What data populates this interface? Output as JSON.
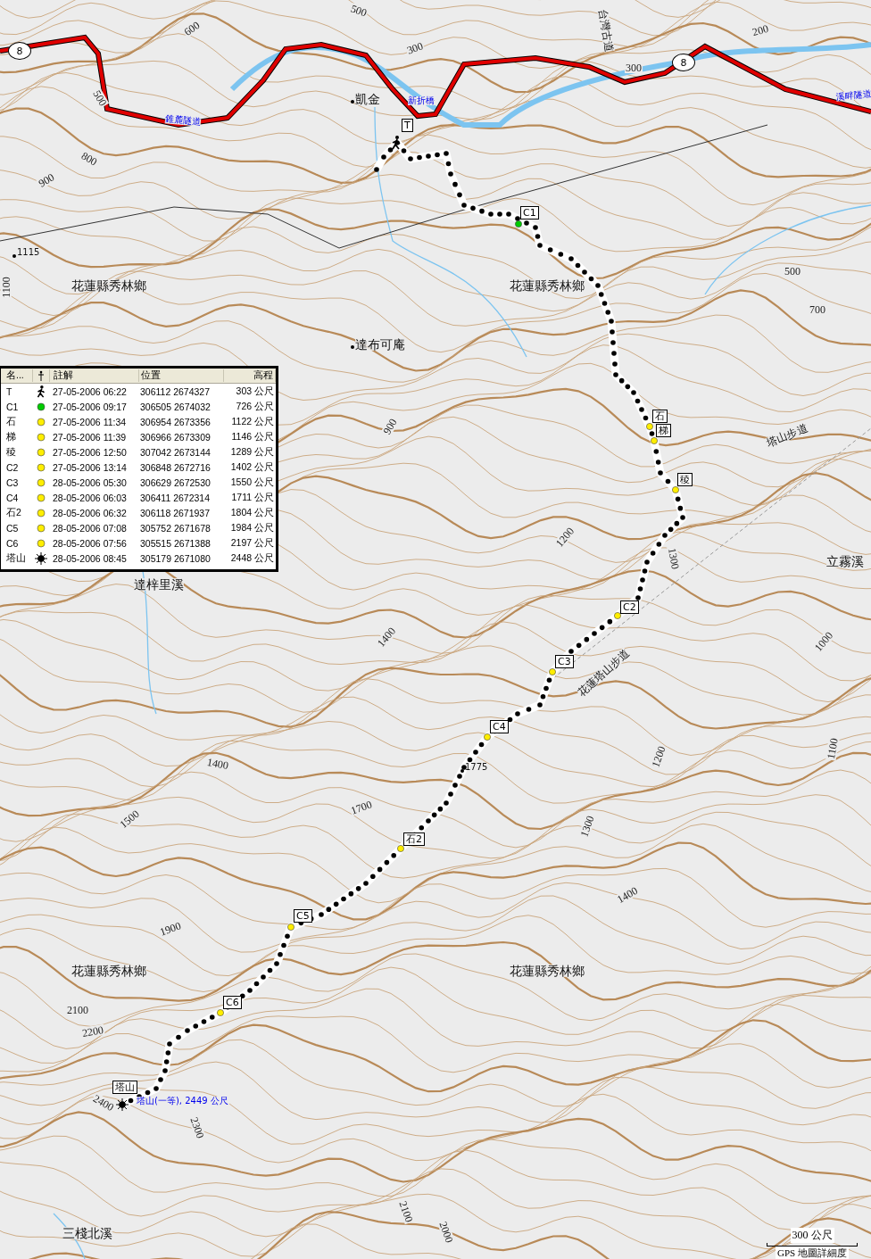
{
  "map": {
    "road_shields": [
      "8",
      "8"
    ],
    "road_labels": [
      "錐麓隧道",
      "新折橋",
      "溪畔隧道"
    ],
    "trail_labels": [
      "台灣古道",
      "塔山步道",
      "花蓮塔山步道"
    ],
    "place_labels": [
      "凱金",
      "達布可庵",
      "花蓮縣秀林鄉",
      "花蓮縣秀林鄉",
      "達梓里溪",
      "立霧溪",
      "花蓮縣秀林鄉",
      "花蓮縣秀林鄉",
      "三棧北溪"
    ],
    "spot_heights": [
      "1115",
      "1775"
    ],
    "contour_labels": [
      "500",
      "600",
      "300",
      "200",
      "300",
      "500",
      "800",
      "900",
      "1100",
      "500",
      "700",
      "900",
      "1200",
      "1300",
      "1400",
      "1400",
      "1500",
      "1700",
      "1300",
      "1200",
      "1000",
      "1100",
      "1900",
      "2100",
      "2200",
      "2400",
      "2300",
      "2100",
      "2000",
      "1400"
    ],
    "waypoints": [
      {
        "label": "T",
        "kind": "trailhead"
      },
      {
        "label": "C1",
        "kind": "waypoint",
        "color": "#00cc00"
      },
      {
        "label": "石",
        "kind": "waypoint",
        "color": "#ffee00"
      },
      {
        "label": "梯",
        "kind": "waypoint",
        "color": "#ffee00"
      },
      {
        "label": "稜",
        "kind": "waypoint",
        "color": "#ffee00"
      },
      {
        "label": "C2",
        "kind": "waypoint",
        "color": "#ffee00"
      },
      {
        "label": "C3",
        "kind": "waypoint",
        "color": "#ffee00"
      },
      {
        "label": "C4",
        "kind": "waypoint",
        "color": "#ffee00"
      },
      {
        "label": "石2",
        "kind": "waypoint",
        "color": "#ffee00"
      },
      {
        "label": "C5",
        "kind": "waypoint",
        "color": "#ffee00"
      },
      {
        "label": "C6",
        "kind": "waypoint",
        "color": "#ffee00"
      },
      {
        "label": "塔山",
        "kind": "summit"
      }
    ],
    "summit_label": "塔山(一等), 2449 公尺",
    "scale": {
      "distance": "300 公尺",
      "detail": "GPS 地圖詳細度"
    }
  },
  "waypoint_table": {
    "columns": [
      "名...",
      "註解",
      "位置",
      "高程"
    ],
    "rows": [
      {
        "name": "T",
        "kind": "trailhead",
        "comment": "27-05-2006 06:22",
        "position": "306112 2674327",
        "elevation": "303 公尺"
      },
      {
        "name": "C1",
        "kind": "waypoint",
        "color": "#00cc00",
        "comment": "27-05-2006 09:17",
        "position": "306505 2674032",
        "elevation": "726 公尺"
      },
      {
        "name": "石",
        "kind": "waypoint",
        "color": "#ffee00",
        "comment": "27-05-2006 11:34",
        "position": "306954 2673356",
        "elevation": "1122 公尺"
      },
      {
        "name": "梯",
        "kind": "waypoint",
        "color": "#ffee00",
        "comment": "27-05-2006 11:39",
        "position": "306966 2673309",
        "elevation": "1146 公尺"
      },
      {
        "name": "稜",
        "kind": "waypoint",
        "color": "#ffee00",
        "comment": "27-05-2006 12:50",
        "position": "307042 2673144",
        "elevation": "1289 公尺"
      },
      {
        "name": "C2",
        "kind": "waypoint",
        "color": "#ffee00",
        "comment": "27-05-2006 13:14",
        "position": "306848 2672716",
        "elevation": "1402 公尺"
      },
      {
        "name": "C3",
        "kind": "waypoint",
        "color": "#ffee00",
        "comment": "28-05-2006 05:30",
        "position": "306629 2672530",
        "elevation": "1550 公尺"
      },
      {
        "name": "C4",
        "kind": "waypoint",
        "color": "#ffee00",
        "comment": "28-05-2006 06:03",
        "position": "306411 2672314",
        "elevation": "1711 公尺"
      },
      {
        "name": "石2",
        "kind": "waypoint",
        "color": "#ffee00",
        "comment": "28-05-2006 06:32",
        "position": "306118 2671937",
        "elevation": "1804 公尺"
      },
      {
        "name": "C5",
        "kind": "waypoint",
        "color": "#ffee00",
        "comment": "28-05-2006 07:08",
        "position": "305752 2671678",
        "elevation": "1984 公尺"
      },
      {
        "name": "C6",
        "kind": "waypoint",
        "color": "#ffee00",
        "comment": "28-05-2006 07:56",
        "position": "305515 2671388",
        "elevation": "2197 公尺"
      },
      {
        "name": "塔山",
        "kind": "summit",
        "comment": "28-05-2006 08:45",
        "position": "305179 2671080",
        "elevation": "2448 公尺"
      }
    ]
  }
}
